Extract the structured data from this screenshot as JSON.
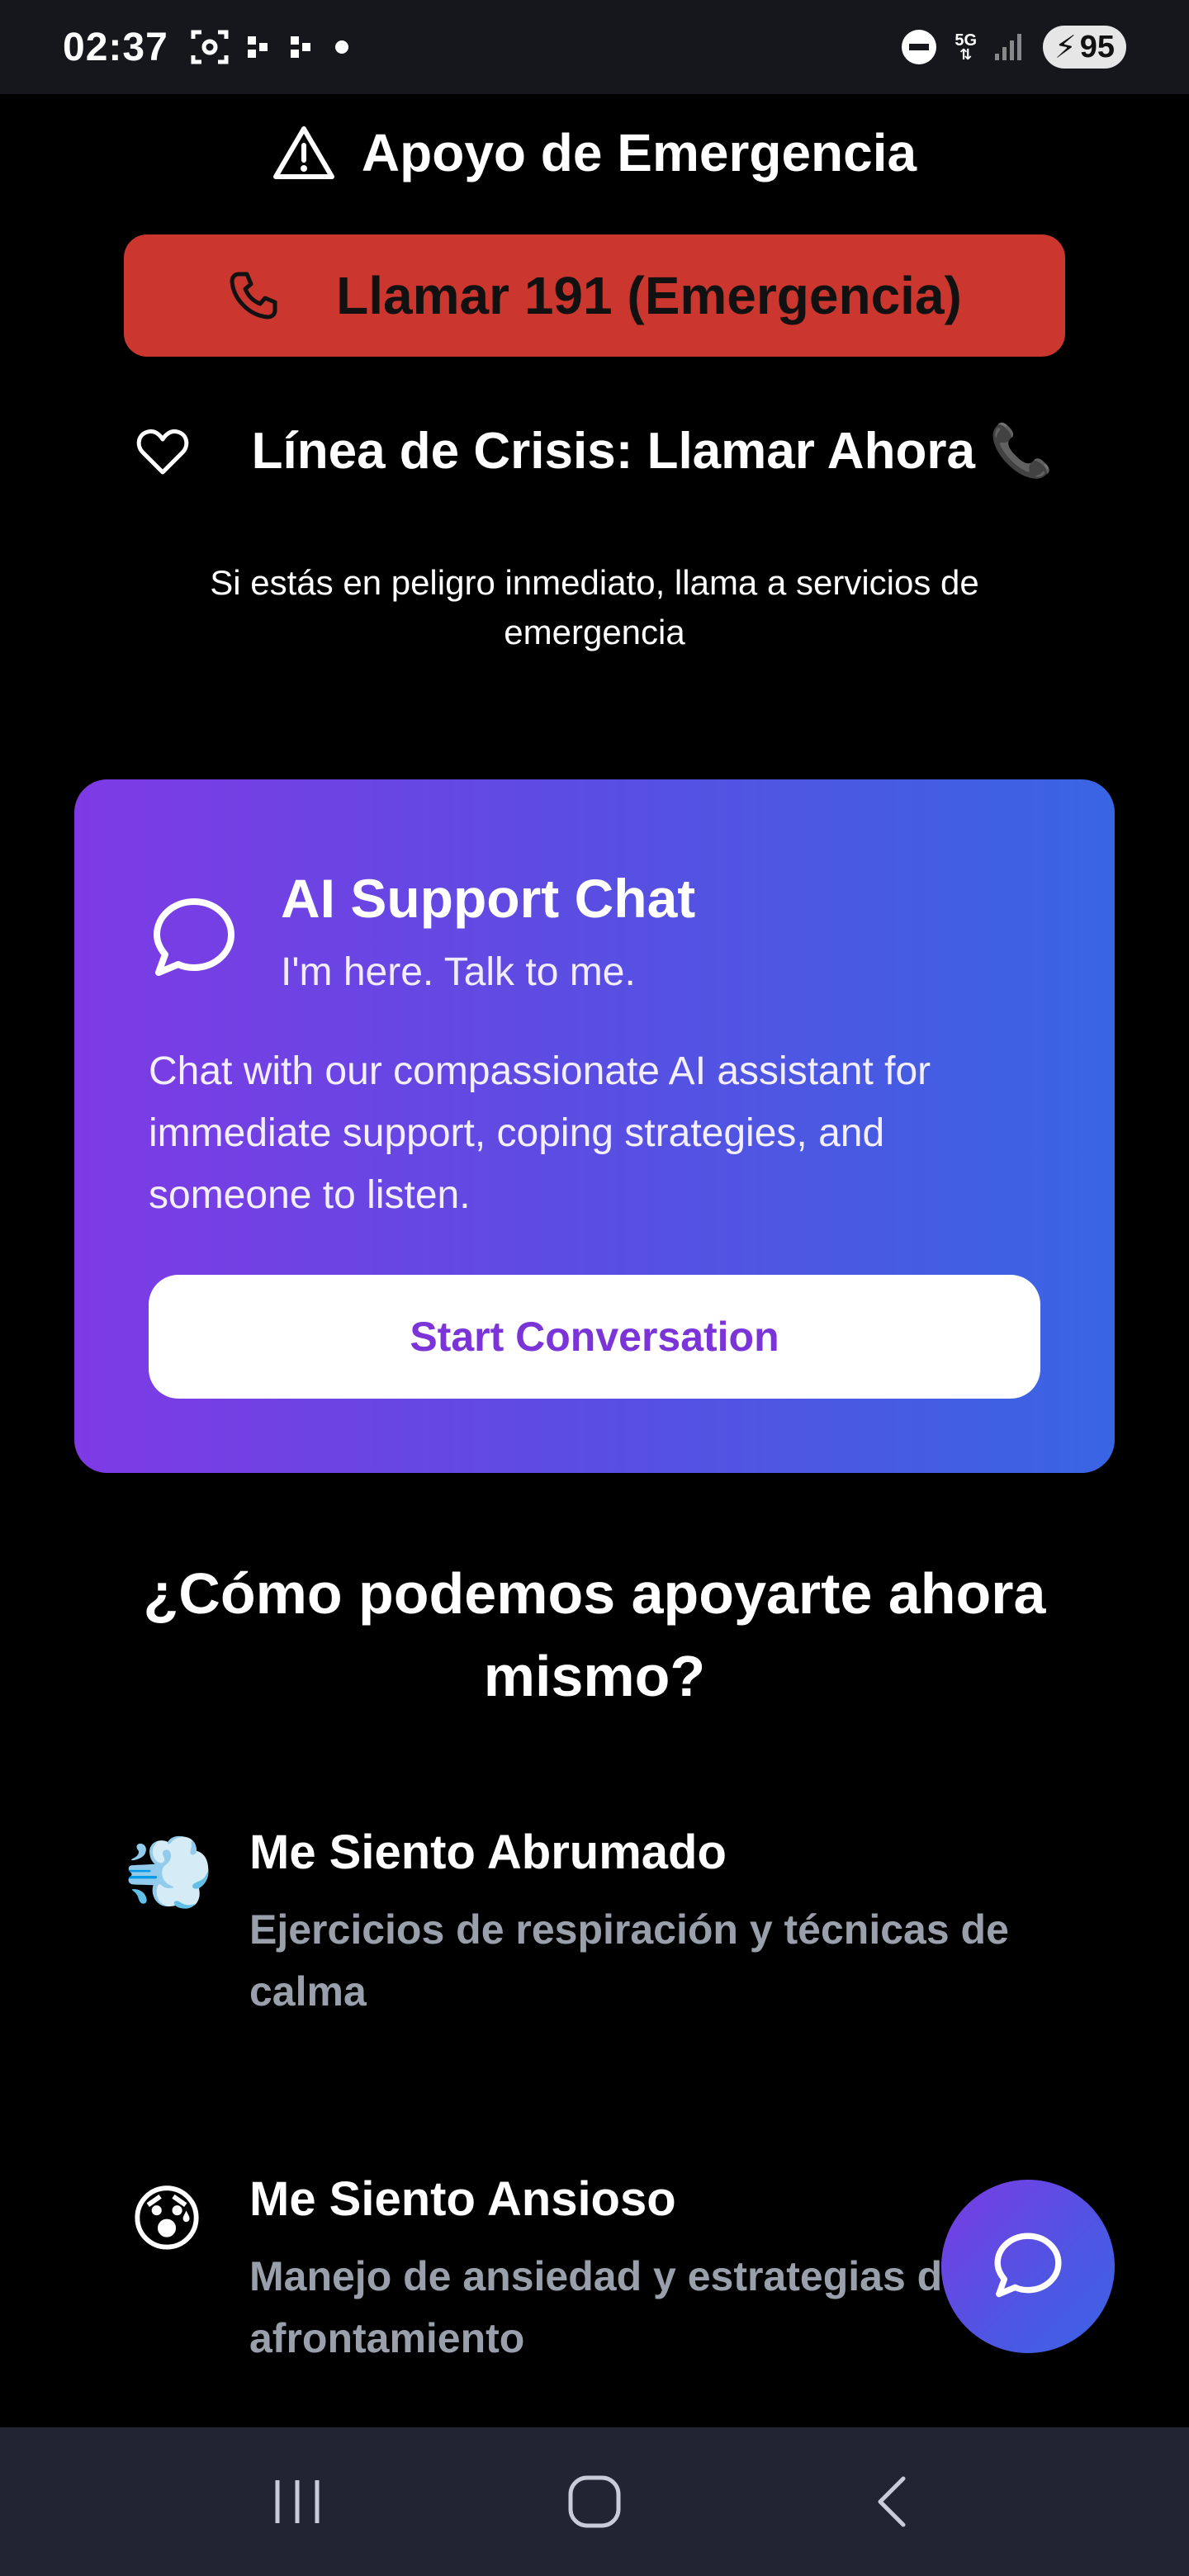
{
  "status_bar": {
    "time": "02:37",
    "network_label_top": "5G",
    "battery_level": "95",
    "icons": [
      "screenshot-icon",
      "notification-dots-icon",
      "notification-dots-icon",
      "dot-icon",
      "do-not-disturb-icon",
      "network-5g-icon",
      "signal-icon",
      "battery-icon"
    ]
  },
  "emergency": {
    "title": "Apoyo de Emergencia",
    "call_button_label": "Llamar 191 (Emergencia)",
    "crisis_line_label": "Línea de Crisis: Llamar Ahora 📞",
    "danger_note": "Si estás en peligro inmediato, llama a servicios de emergencia"
  },
  "ai_card": {
    "title": "AI Support Chat",
    "subtitle": "I'm here. Talk to me.",
    "description": "Chat with our compassionate AI assistant for immediate support, coping strategies, and someone to listen.",
    "button_label": "Start Conversation"
  },
  "support": {
    "heading": "¿Cómo podemos apoyarte ahora mismo?",
    "options": [
      {
        "emoji": "💨",
        "title": "Me Siento Abrumado",
        "description": "Ejercicios de respiración y técnicas de calma"
      },
      {
        "emoji": "😰",
        "title": "Me Siento Ansioso",
        "description": "Manejo de ansiedad y estrategias de afrontamiento"
      }
    ]
  },
  "colors": {
    "emergency_red": "#cb372e",
    "card_gradient_start": "#7e3ae4",
    "card_gradient_end": "#3865e3",
    "button_text_purple": "#7b34d8",
    "muted_text": "#9aa0ab",
    "nav_bar": "#202531"
  },
  "navigation": {
    "buttons": [
      "recent-apps",
      "home",
      "back"
    ]
  }
}
